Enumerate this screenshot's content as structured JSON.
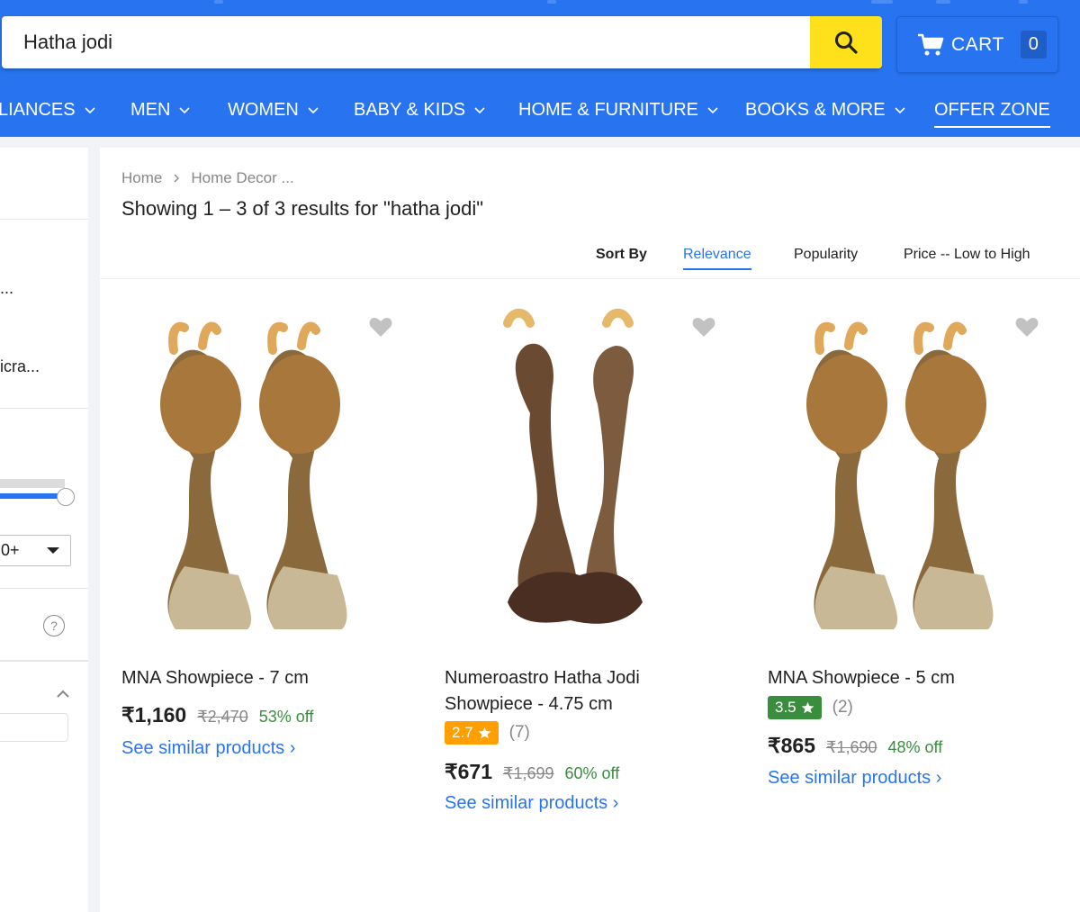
{
  "header": {
    "search_value": "Hatha jodi",
    "cart_label": "CART",
    "cart_count": "0"
  },
  "nav": {
    "items": [
      {
        "label": "LIANCES",
        "has_chevron": true
      },
      {
        "label": "MEN",
        "has_chevron": true
      },
      {
        "label": "WOMEN",
        "has_chevron": true
      },
      {
        "label": "BABY & KIDS",
        "has_chevron": true
      },
      {
        "label": "HOME & FURNITURE",
        "has_chevron": true
      },
      {
        "label": "BOOKS & MORE",
        "has_chevron": true
      },
      {
        "label": "OFFER ZONE",
        "has_chevron": false,
        "active": true
      }
    ]
  },
  "sidebar": {
    "text_1": "...",
    "text_2": "icra...",
    "select_value": "0+",
    "help_glyph": "?"
  },
  "breadcrumb": {
    "home": "Home",
    "current": "Home Decor ..."
  },
  "results_title": "Showing 1 – 3 of 3 results for \"hatha jodi\"",
  "sort": {
    "label": "Sort By",
    "options": [
      "Relevance",
      "Popularity",
      "Price -- Low to High"
    ],
    "active": "Relevance"
  },
  "products": [
    {
      "name": "MNA Showpiece - 7 cm",
      "rating": null,
      "rating_count": null,
      "price": "₹1,160",
      "mrp": "₹2,470",
      "discount": "53% off",
      "similar": "See similar products ›"
    },
    {
      "name": "Numeroastro Hatha Jodi Showpiece - 4.75 cm",
      "rating": "2.7",
      "rating_count": "(7)",
      "rating_color": "#ff9f00",
      "price": "₹671",
      "mrp": "₹1,699",
      "discount": "60% off",
      "similar": "See similar products ›"
    },
    {
      "name": "MNA Showpiece - 5 cm",
      "rating": "3.5",
      "rating_count": "(2)",
      "rating_color": "#388e3c",
      "price": "₹865",
      "mrp": "₹1,690",
      "discount": "48% off",
      "similar": "See similar products ›"
    }
  ],
  "colors": {
    "brand_blue": "#2874f0",
    "search_button": "#ffe11b",
    "discount_green": "#388e3c"
  },
  "icons": [
    "search-icon",
    "cart-icon",
    "chevron-down-icon",
    "chevron-right-icon",
    "heart-icon",
    "star-icon",
    "help-icon",
    "chevron-up-icon",
    "dropdown-caret-icon"
  ]
}
